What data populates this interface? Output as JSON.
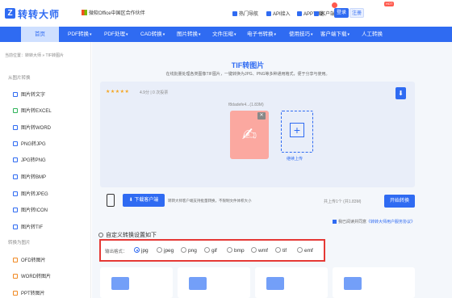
{
  "header": {
    "logo_text": "转转大师",
    "partner_text": "微软Office中国区合作伙伴",
    "links": [
      "热门导航",
      "API接入",
      "APP下载",
      "客户端"
    ],
    "login_label": "登录",
    "register_label": "注册"
  },
  "nav": {
    "items": [
      "首页",
      "PDF转换",
      "PDF处理",
      "CAD转换",
      "图片转换",
      "文件压缩",
      "电子书转换",
      "使用技巧",
      "客户端下载",
      "人工转换"
    ],
    "hot_badge": "HOT"
  },
  "breadcrumb": "当前位置：转转大师 » TIF转图片",
  "sidebar": {
    "group1_label": "从图片转换",
    "group1_items": [
      "图片转文字",
      "图片转EXCEL",
      "图片转WORD",
      "PNG转JPG",
      "JPG转PNG",
      "图片转BMP",
      "图片转JPEG",
      "图片转ICON",
      "图片转TIF"
    ],
    "group2_label": "转换为图片",
    "group2_items": [
      "OFD转图片",
      "WORD转图片",
      "PPT转图片"
    ]
  },
  "main": {
    "title": "TIF转图片",
    "subtitle": "在线批量处理各类图像TIF图片，一键转换为JPG、PNG等多种通用格式，便于分享与使用。",
    "stars": "★★★★★",
    "rating_text": "4.9分 | 0 次投票",
    "file_name": "f8dadefe4...(1.83M)",
    "add_label": "继续上传",
    "download_client_label": "下载客户端",
    "download_tip": "转转大师客户端支持批量转换，不限制文件体积大小",
    "quota_text": "共上传1个 (共1.83M)",
    "start_label": "开始转换",
    "agree_prefix": "我已阅读并同意",
    "agree_link": "《转转大师用户服务协议》",
    "custom_settings_label": "自定义转换设置如下",
    "output_format_label": "输出格式：",
    "formats": [
      "jpg",
      "jpeg",
      "png",
      "gif",
      "bmp",
      "wmf",
      "tif",
      "emf"
    ],
    "selected_format": "jpg"
  },
  "colors": {
    "primary": "#2f6bf2",
    "highlight_border": "#e53935",
    "pdf_card": "#fba8a0"
  }
}
